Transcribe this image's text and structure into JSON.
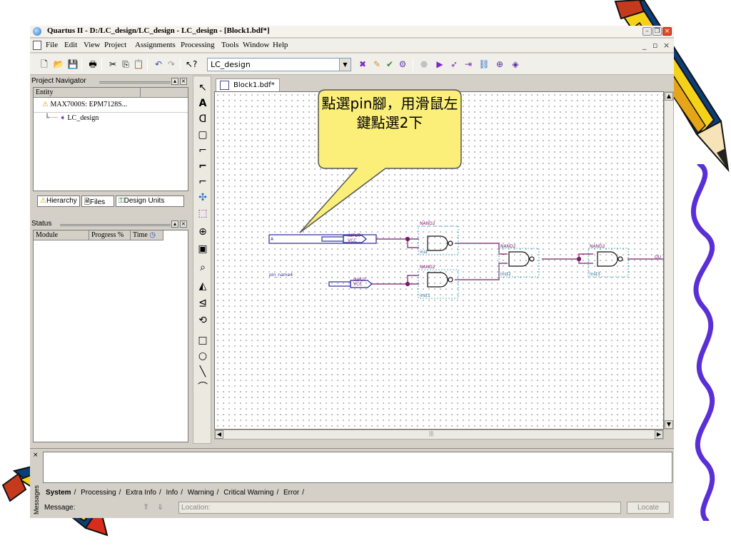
{
  "window": {
    "title": "Quartus II - D:/LC_design/LC_design - LC_design - [Block1.bdf*]"
  },
  "menu": {
    "items": [
      "File",
      "Edit",
      "View",
      "Project",
      "Assignments",
      "Processing",
      "Tools",
      "Window",
      "Help"
    ]
  },
  "toolbar": {
    "project_select": "LC_design"
  },
  "project_navigator": {
    "title": "Project Navigator",
    "column": "Entity",
    "device": "MAX7000S: EPM7128S...",
    "entity": "LC_design",
    "tabs": [
      "Hierarchy",
      "Files",
      "Design Units"
    ]
  },
  "status_panel": {
    "title": "Status",
    "columns": [
      "Module",
      "Progress %",
      "Time"
    ]
  },
  "document": {
    "tab": "Block1.bdf*"
  },
  "schematic": {
    "pins": [
      {
        "name": "A",
        "type": "INPUT",
        "default": "VCC"
      },
      {
        "name": "pin_name4",
        "type": "INPUT",
        "default": "VCC"
      }
    ],
    "gates": [
      {
        "type": "NAND2",
        "instance": "inst"
      },
      {
        "type": "NAND2",
        "instance": "inst1"
      },
      {
        "type": "NAND2",
        "instance": "inst2"
      },
      {
        "type": "NAND2",
        "instance": "inst3"
      }
    ],
    "output_label": "OU"
  },
  "messages": {
    "side_label": "Messages",
    "tabs": [
      "System",
      "Processing",
      "Extra Info",
      "Info",
      "Warning",
      "Critical Warning",
      "Error"
    ],
    "message_label": "Message:",
    "location_placeholder": "Location:",
    "locate_button": "Locate"
  },
  "callout": {
    "text": "點選pin腳，用滑鼠左鍵點選2下"
  }
}
